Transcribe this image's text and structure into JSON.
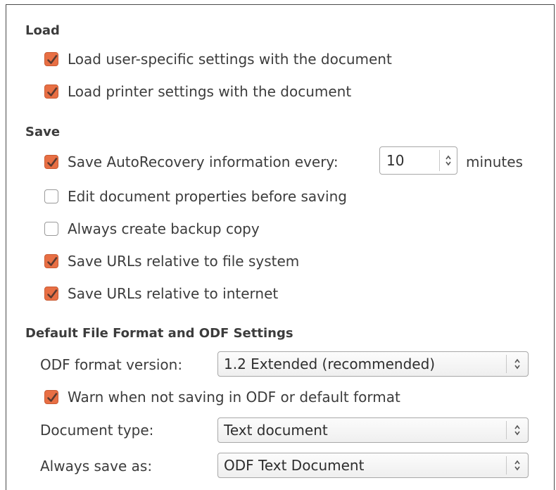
{
  "load": {
    "title": "Load",
    "user_settings": {
      "label": "Load user-specific settings with the document",
      "checked": true
    },
    "printer_settings": {
      "label": "Load printer settings with the document",
      "checked": true
    }
  },
  "save": {
    "title": "Save",
    "autorecovery": {
      "label": "Save AutoRecovery information every:",
      "checked": true,
      "value": "10",
      "unit": "minutes"
    },
    "edit_properties": {
      "label": "Edit document properties before saving",
      "checked": false
    },
    "backup_copy": {
      "label": "Always create backup copy",
      "checked": false
    },
    "urls_filesystem": {
      "label": "Save URLs relative to file system",
      "checked": true
    },
    "urls_internet": {
      "label": "Save URLs relative to internet",
      "checked": true
    }
  },
  "format": {
    "title": "Default File Format and ODF Settings",
    "odf_version_label": "ODF format version:",
    "odf_version_value": "1.2 Extended (recommended)",
    "warn": {
      "label": "Warn when not saving in ODF or default format",
      "checked": true
    },
    "doc_type_label": "Document type:",
    "doc_type_value": "Text document",
    "save_as_label": "Always save as:",
    "save_as_value": "ODF Text Document"
  },
  "colors": {
    "accent": "#e86f44"
  }
}
